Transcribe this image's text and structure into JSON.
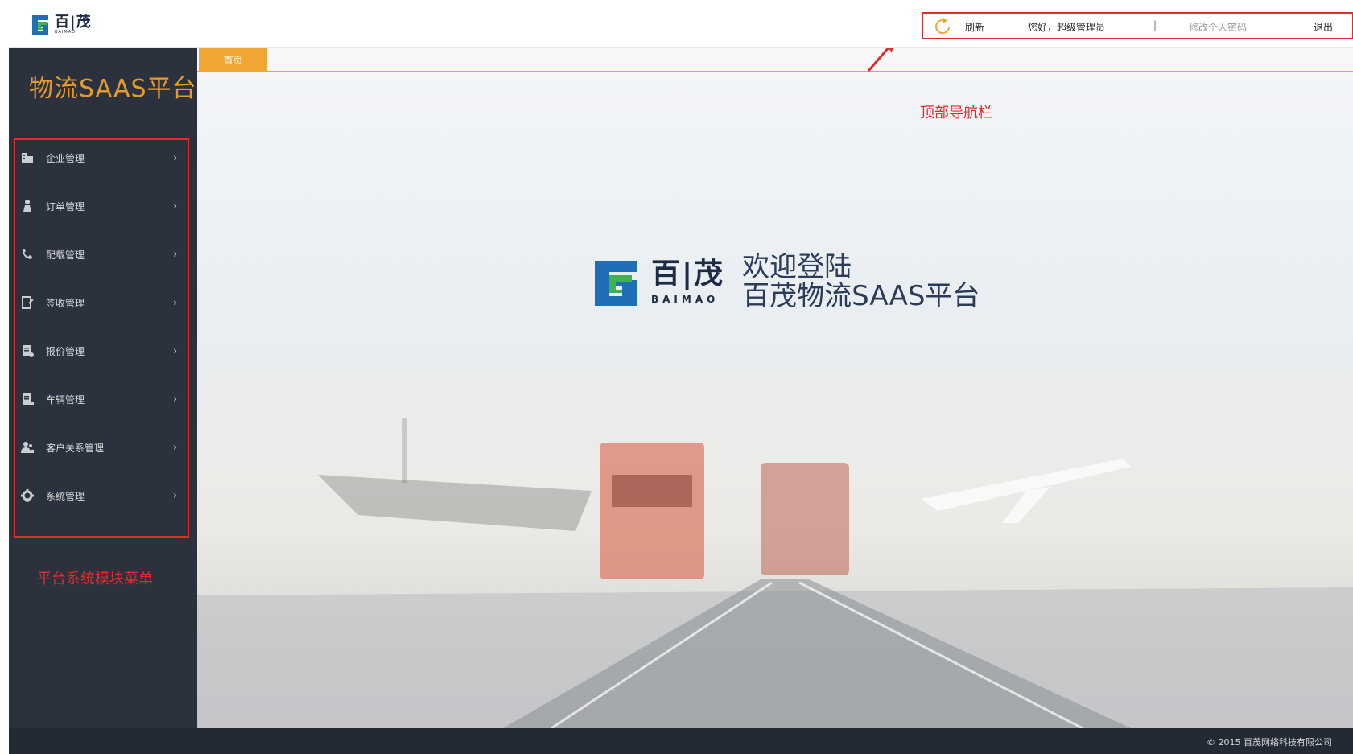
{
  "header": {
    "logo_cn": "百|茂",
    "logo_en": "BAIMAO",
    "nav": {
      "refresh": "刷新",
      "greeting": "您好，超级管理员",
      "separator": "|",
      "change_password": "修改个人密码",
      "logout": "退出"
    }
  },
  "sidebar": {
    "title": "物流SAAS平台",
    "items": [
      {
        "label": "企业管理",
        "icon": "building-icon"
      },
      {
        "label": "订单管理",
        "icon": "person-cart-icon"
      },
      {
        "label": "配载管理",
        "icon": "phone-route-icon"
      },
      {
        "label": "签收管理",
        "icon": "sign-doc-icon"
      },
      {
        "label": "报价管理",
        "icon": "quote-doc-icon"
      },
      {
        "label": "车辆管理",
        "icon": "vehicle-doc-icon"
      },
      {
        "label": "客户关系管理",
        "icon": "customers-icon"
      },
      {
        "label": "系统管理",
        "icon": "gear-icon"
      }
    ],
    "note": "平台系统模块菜单"
  },
  "tabs": {
    "home": "首页"
  },
  "annotations": {
    "topnav": "顶部导航栏"
  },
  "welcome": {
    "brand_cn": "百|茂",
    "brand_en": "BAIMAO",
    "line1": "欢迎登陆",
    "line2": "百茂物流SAAS平台"
  },
  "footer": {
    "copyright": "© 2015 百茂网络科技有限公司"
  },
  "colors": {
    "sidebar_bg": "#2b323d",
    "accent_orange": "#f0a632",
    "annotation_red": "#e12c2c",
    "brand_green": "#3fb34f",
    "brand_blue": "#1f6fb6"
  }
}
